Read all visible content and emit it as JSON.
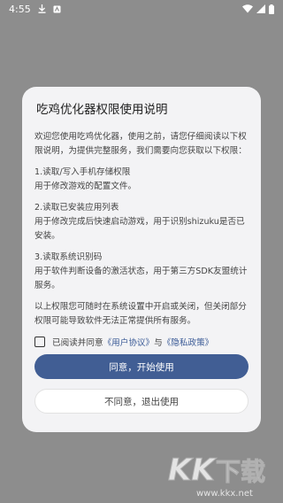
{
  "status_bar": {
    "time": "4:55"
  },
  "dialog": {
    "title": "吃鸡优化器权限使用说明",
    "intro": "欢迎您使用吃鸡优化器，使用之前，请您仔细阅读以下权限说明，为提供完整服务，我们需要向您获取以下权限：",
    "items": [
      {
        "head": "1.读取/写入手机存储权限",
        "desc": "用于修改游戏的配置文件。"
      },
      {
        "head": "2.读取已安装应用列表",
        "desc": "用于修改完成后快速启动游戏，用于识别shizuku是否已安装。"
      },
      {
        "head": "3.读取系统识别码",
        "desc": "用于软件判断设备的激活状态，用于第三方SDK友盟统计服务。"
      }
    ],
    "note": "以上权限您可随时在系统设置中开启或关闭，但关闭部分权限可能导致软件无法正常提供所有服务。",
    "agree_prefix": "已阅读并同意",
    "user_agreement": "《用户协议》",
    "and": "与",
    "privacy_policy": "《隐私政策》",
    "accept_button": "同意，开始使用",
    "reject_button": "不同意，退出使用"
  },
  "watermark": {
    "text": "KK下载",
    "url": "www.kkx.net"
  },
  "colors": {
    "primary": "#415e94",
    "link": "#3a5a96",
    "background_overlay": "#8d8d8d"
  }
}
